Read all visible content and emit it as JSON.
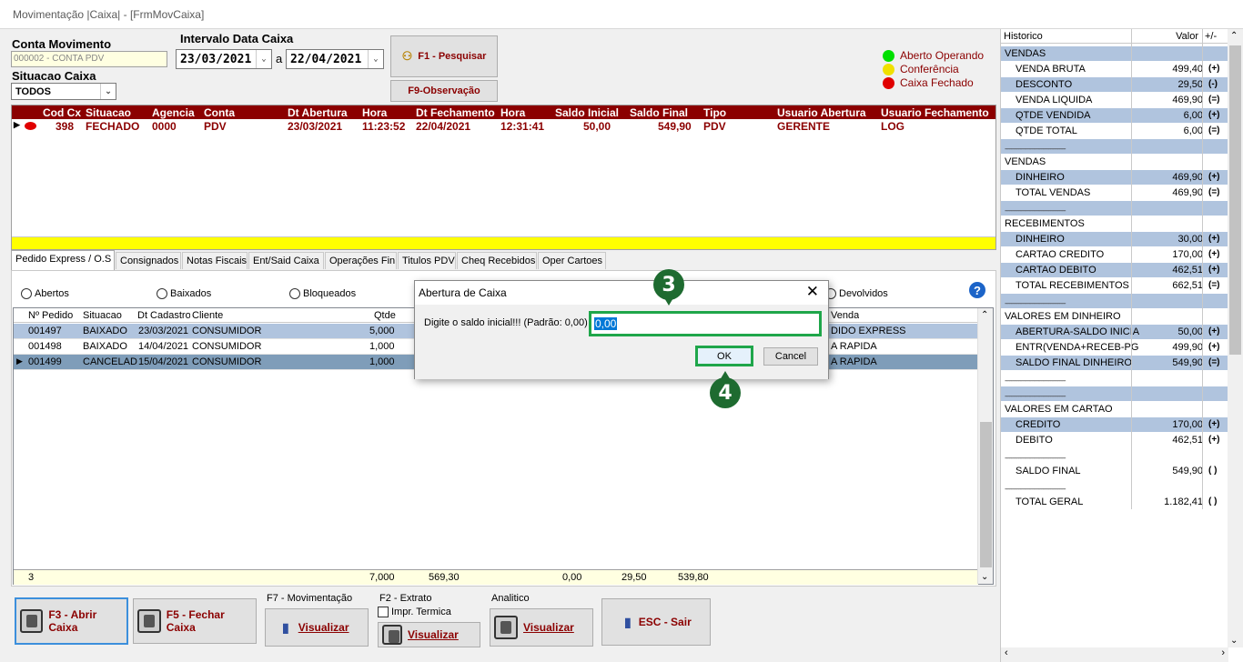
{
  "window": {
    "title": "Movimentação |Caixa| - [FrmMovCaixa]"
  },
  "filters": {
    "conta_label": "Conta Movimento",
    "conta_value": "000002 - CONTA PDV",
    "situacao_label": "Situacao Caixa",
    "situacao_value": "TODOS",
    "intervalo_label": "Intervalo Data Caixa",
    "data_inicio": "23/03/2021",
    "data_sep": "a",
    "data_fim": "22/04/2021",
    "pesquisar_label": "F1 - Pesquisar",
    "observacao_label": "F9-Observação"
  },
  "legend": [
    {
      "label": "Aberto Operando",
      "color": "#00e000"
    },
    {
      "label": "Conferência",
      "color": "#f0e000"
    },
    {
      "label": "Caixa Fechado",
      "color": "#e00000"
    }
  ],
  "caixa_grid": {
    "columns": [
      "Cod Cx",
      "Situacao",
      "Agencia",
      "Conta",
      "Dt Abertura",
      "Hora",
      "Dt Fechamento",
      "Hora",
      "Saldo Inicial",
      "Saldo Final",
      "Tipo",
      "Usuario Abertura",
      "Usuario Fechamento"
    ],
    "row": [
      "398",
      "FECHADO",
      "0000",
      "PDV",
      "23/03/2021",
      "11:23:52",
      "22/04/2021",
      "12:31:41",
      "50,00",
      "549,90",
      "PDV",
      "GERENTE",
      "LOG"
    ]
  },
  "tabs": [
    "Pedido Express / O.S",
    "Consignados",
    "Notas Fiscais",
    "Ent/Said Caixa",
    "Operações Fin",
    "Titulos PDV",
    "Cheq Recebidos",
    "Oper Cartoes"
  ],
  "radios": [
    "Abertos",
    "Baixados",
    "Bloqueados",
    "Devolvidos"
  ],
  "pedidos_grid": {
    "columns": [
      "Nº Pedido",
      "Situacao",
      "Dt Cadastro",
      "Cliente",
      "Qtde",
      "Venda"
    ],
    "rows": [
      {
        "pedido": "001497",
        "situacao": "BAIXADO",
        "dt": "23/03/2021",
        "cliente": "CONSUMIDOR",
        "qtde": "5,000",
        "venda": "DIDO EXPRESS"
      },
      {
        "pedido": "001498",
        "situacao": "BAIXADO",
        "dt": "14/04/2021",
        "cliente": "CONSUMIDOR",
        "qtde": "1,000",
        "venda": "A RAPIDA"
      },
      {
        "pedido": "001499",
        "situacao": "CANCELAD",
        "dt": "15/04/2021",
        "cliente": "CONSUMIDOR",
        "qtde": "1,000",
        "venda": "A RAPIDA"
      }
    ],
    "footer": [
      "3",
      "7,000",
      "569,30",
      "0,00",
      "29,50",
      "539,80"
    ]
  },
  "bottom": {
    "abrir": "F3 - Abrir Caixa",
    "fechar": "F5 - Fechar Caixa",
    "mov_label": "F7 - Movimentação",
    "extrato_label": "F2 - Extrato",
    "impr_label": "Impr. Termica",
    "analitico_label": "Analitico",
    "visualizar": "Visualizar",
    "sair": "ESC - Sair"
  },
  "historico": {
    "headers": [
      "Historico",
      "Valor",
      "+/-"
    ],
    "rows": [
      {
        "label": "VENDAS",
        "value": "",
        "sign": "",
        "style": "blue",
        "indent": false
      },
      {
        "label": "VENDA BRUTA",
        "value": "499,40",
        "sign": "(+)",
        "style": "white",
        "indent": true
      },
      {
        "label": "DESCONTO",
        "value": "29,50",
        "sign": "(-)",
        "style": "blue",
        "indent": true
      },
      {
        "label": "VENDA LIQUIDA",
        "value": "469,90",
        "sign": "(=)",
        "style": "white",
        "indent": true
      },
      {
        "label": "QTDE VENDIDA",
        "value": "6,00",
        "sign": "(+)",
        "style": "blue",
        "indent": true
      },
      {
        "label": "QTDE TOTAL",
        "value": "6,00",
        "sign": "(=)",
        "style": "white",
        "indent": true
      },
      {
        "label": "----------------------------------------",
        "value": "",
        "sign": "",
        "style": "blue",
        "indent": false
      },
      {
        "label": "VENDAS",
        "value": "",
        "sign": "",
        "style": "white",
        "indent": false
      },
      {
        "label": "DINHEIRO",
        "value": "469,90",
        "sign": "(+)",
        "style": "blue",
        "indent": true
      },
      {
        "label": "TOTAL VENDAS",
        "value": "469,90",
        "sign": "(=)",
        "style": "white",
        "indent": true
      },
      {
        "label": "----------------------------------------",
        "value": "",
        "sign": "",
        "style": "blue",
        "indent": false
      },
      {
        "label": "RECEBIMENTOS",
        "value": "",
        "sign": "",
        "style": "white",
        "indent": false
      },
      {
        "label": "DINHEIRO",
        "value": "30,00",
        "sign": "(+)",
        "style": "blue",
        "indent": true
      },
      {
        "label": "CARTAO CREDITO",
        "value": "170,00",
        "sign": "(+)",
        "style": "white",
        "indent": true
      },
      {
        "label": "CARTAO DEBITO",
        "value": "462,51",
        "sign": "(+)",
        "style": "blue",
        "indent": true
      },
      {
        "label": "TOTAL RECEBIMENTOS",
        "value": "662,51",
        "sign": "(=)",
        "style": "white",
        "indent": true
      },
      {
        "label": "----------------------------------------",
        "value": "",
        "sign": "",
        "style": "blue",
        "indent": false
      },
      {
        "label": "VALORES EM DINHEIRO",
        "value": "",
        "sign": "",
        "style": "white",
        "indent": false
      },
      {
        "label": "ABERTURA-SALDO INICIA",
        "value": "50,00",
        "sign": "(+)",
        "style": "blue",
        "indent": true
      },
      {
        "label": "ENTR(VENDA+RECEB-PG",
        "value": "499,90",
        "sign": "(+)",
        "style": "white",
        "indent": true
      },
      {
        "label": "SALDO FINAL DINHEIRO",
        "value": "549,90",
        "sign": "(=)",
        "style": "blue",
        "indent": true
      },
      {
        "label": "----------------------------------------",
        "value": "",
        "sign": "",
        "style": "white",
        "indent": false
      },
      {
        "label": "----------------------------------------",
        "value": "",
        "sign": "",
        "style": "blue",
        "indent": false
      },
      {
        "label": "VALORES EM CARTAO",
        "value": "",
        "sign": "",
        "style": "white",
        "indent": false
      },
      {
        "label": "CREDITO",
        "value": "170,00",
        "sign": "(+)",
        "style": "blue",
        "indent": true
      },
      {
        "label": "DEBITO",
        "value": "462,51",
        "sign": "(+)",
        "style": "white",
        "indent": true
      },
      {
        "label": "----------------------------------------",
        "value": "",
        "sign": "",
        "style": "white",
        "indent": false
      },
      {
        "label": "SALDO FINAL",
        "value": "549,90",
        "sign": "( )",
        "style": "white",
        "indent": true
      },
      {
        "label": "----------------------------------------",
        "value": "",
        "sign": "",
        "style": "white",
        "indent": false
      },
      {
        "label": "TOTAL GERAL",
        "value": "1.182,41",
        "sign": "( )",
        "style": "white",
        "indent": true
      }
    ]
  },
  "dialog": {
    "title": "Abertura de Caixa",
    "prompt": "Digite o saldo inicial!!! (Padrão: 0,00)",
    "value": "0,00",
    "ok": "OK",
    "cancel": "Cancel"
  },
  "markers": {
    "step3": "3",
    "step4": "4"
  },
  "colors": {
    "highlight": "#1fa64a",
    "header": "#8b0000",
    "selected_row": "#7f9db9",
    "blue_row": "#b0c4de"
  }
}
